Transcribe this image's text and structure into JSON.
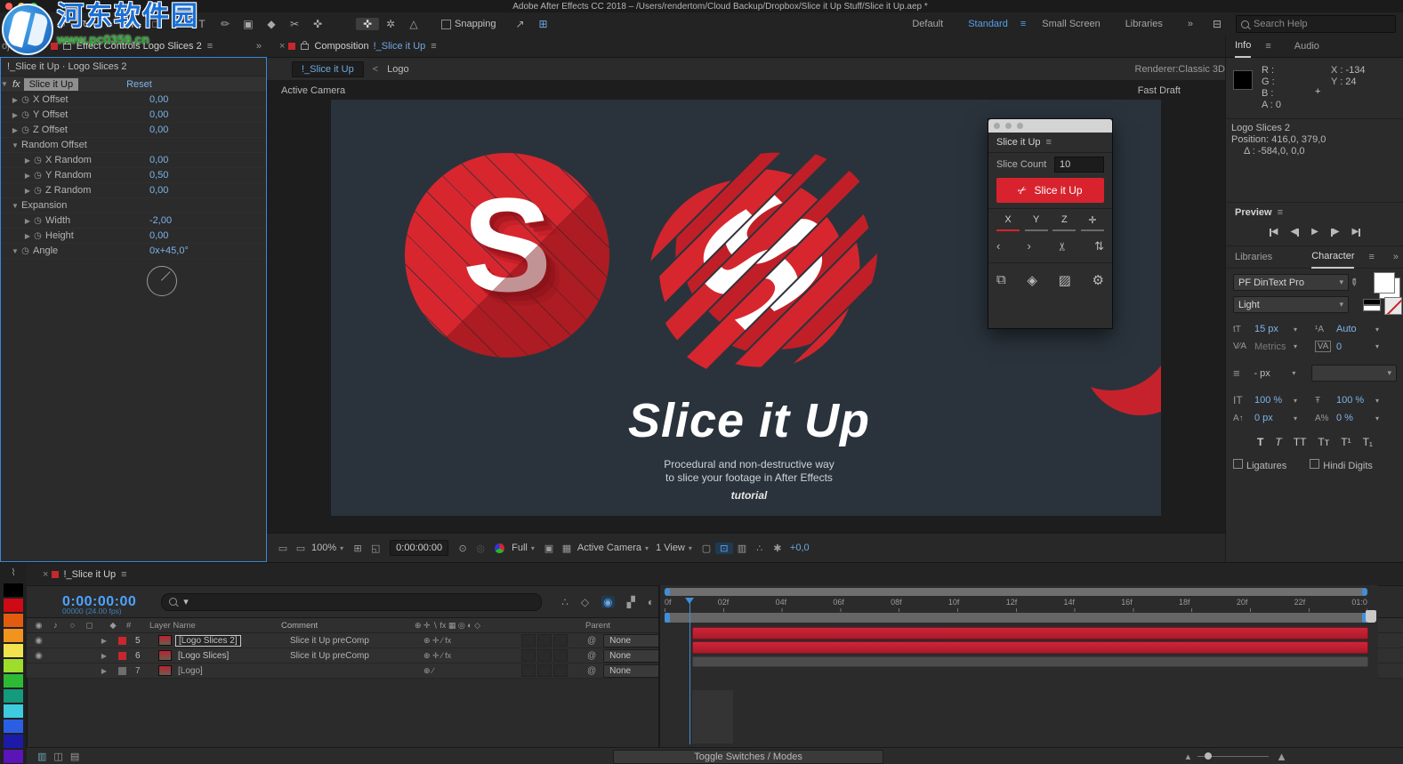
{
  "titlebar": {
    "title": "Adobe After Effects CC 2018 – /Users/rendertom/Cloud Backup/Dropbox/Slice it Up Stuff/Slice it Up.aep *"
  },
  "watermark": {
    "site_name": "河东软件园",
    "site_url": "www.pc0359.cn"
  },
  "toolbar": {
    "tools": [
      "↖",
      "✷",
      "⌕",
      "↻",
      "⌖",
      "✛",
      "□",
      "✒",
      "T",
      "✏",
      "▣",
      "◆",
      "✂",
      "✜"
    ],
    "tool_names": [
      "selection",
      "hand",
      "zoom",
      "rotate",
      "camera",
      "pan-behind",
      "shape",
      "pen",
      "type",
      "brush",
      "clone-stamp",
      "eraser",
      "roto-brush",
      "puppet-pin"
    ],
    "mid_tools": [
      "✜",
      "✲",
      "△"
    ],
    "snapping_label": "Snapping",
    "after_snap": [
      "↗",
      "⊞"
    ],
    "workspaces": [
      "Default",
      "Standard",
      "Small Screen",
      "Libraries"
    ],
    "active_workspace": "Standard",
    "workspace_menu_icon": "≡",
    "overflow": "»",
    "search_placeholder": "Search Help"
  },
  "effect_controls": {
    "project_tab_clip": "oject",
    "tab": "Effect Controls Logo Slices 2",
    "menu": "≡",
    "overflow": "»",
    "close": "×",
    "breadcrumb": "!_Slice it Up · Logo Slices 2",
    "fx_badge": "fx",
    "effect_name": "Slice it Up",
    "reset_label": "Reset",
    "rows": [
      {
        "label": "X Offset",
        "value": "0,00"
      },
      {
        "label": "Y Offset",
        "value": "0,00"
      },
      {
        "label": "Z Offset",
        "value": "0,00"
      },
      {
        "label": "Random Offset",
        "value": ""
      },
      {
        "label": "X Random",
        "value": "0,00"
      },
      {
        "label": "Y Random",
        "value": "0,50"
      },
      {
        "label": "Z Random",
        "value": "0,00"
      },
      {
        "label": "Expansion",
        "value": ""
      },
      {
        "label": "Width",
        "value": "-2,00"
      },
      {
        "label": "Height",
        "value": "0,00"
      },
      {
        "label": "Angle",
        "value": "0x+45,0°"
      }
    ]
  },
  "composition": {
    "close": "×",
    "tab_prefix": "Composition",
    "tab_comp": "!_Slice it Up",
    "menu": "≡",
    "crumb_active": "!_Slice it Up",
    "crumb_sep": "<",
    "crumb_other": "Logo",
    "renderer_label": "Renderer:",
    "renderer_value": "Classic 3D",
    "camera_label": "Active Camera",
    "fast_draft": "Fast Draft",
    "artwork": {
      "letter": "S",
      "title": "Slice it Up",
      "subtitle1": "Procedural and non-destructive way",
      "subtitle2": "to slice your footage in After Effects",
      "tagline": "tutorial",
      "bg_color": "#2a333c",
      "red": "#d8262e"
    },
    "toolbar": {
      "zoom": "100%",
      "timecode": "0:00:00:00",
      "resolution": "Full",
      "view": "Active Camera",
      "views": "1 View",
      "exposure": "+0,0"
    }
  },
  "script_panel": {
    "title": "Slice it Up",
    "menu": "≡",
    "slice_count_label": "Slice Count",
    "slice_count_value": "10",
    "button_label": "Slice it Up",
    "scissors": "✂",
    "axes": [
      "X",
      "Y",
      "Z",
      "✛"
    ],
    "row2": [
      "‹",
      "›",
      "✂",
      "⇅"
    ],
    "row3": [
      "⧉",
      "◈",
      "▨",
      "⚙"
    ],
    "accent": "#d8232e"
  },
  "info_panel": {
    "tab_info": "Info",
    "tab_audio": "Audio",
    "menu": "≡",
    "r": "R :",
    "g": "G :",
    "b": "B :",
    "a": "A :  0",
    "x": "X :  -134",
    "y": "Y :  24",
    "crosshair": "+",
    "layer": "Logo Slices 2",
    "position": "Position: 416,0, 379,0",
    "delta": "Δ : -584,0, 0,0"
  },
  "preview_panel": {
    "title": "Preview",
    "menu": "≡"
  },
  "character_panel": {
    "tab_libraries": "Libraries",
    "tab_character": "Character",
    "menu": "≡",
    "overflow": "»",
    "font": "PF DinText Pro",
    "style": "Light",
    "size_value": "15 px",
    "leading_value": "Auto",
    "kerning_value": "Metrics",
    "tracking_value": "0",
    "stroke_value": "- px",
    "vscale_value": "100 %",
    "hscale_value": "100 %",
    "baseline_value": "0 px",
    "tsume_value": "0 %",
    "icons": {
      "size": "tT",
      "leading": "¹A",
      "kerning": "V∕A",
      "tracking": "VA",
      "stroke": "≡",
      "vscale": "IT",
      "hscale": "Ŧ",
      "baseline": "A↑",
      "tsume": "A%"
    },
    "faux": [
      "T",
      "T",
      "TT",
      "Tᴛ",
      "T¹",
      "T₁"
    ],
    "ligatures_label": "Ligatures",
    "hindi_label": "Hindi Digits"
  },
  "timeline": {
    "close": "×",
    "tab": "!_Slice it Up",
    "menu": "≡",
    "timecode": "0:00:00:00",
    "frames": "00000 (24.00 fps)",
    "right_icons": [
      "∴",
      "◇",
      "◉",
      "▞",
      "◐",
      "∿"
    ],
    "right_icon_names": [
      "comp-mini-flowchart",
      "draft-3d",
      "hide-shy-layers",
      "frame-blending",
      "motion-blur",
      "graph-editor"
    ],
    "av_header_icons": [
      "◉",
      "♪",
      "○",
      "◻"
    ],
    "label_header_icon": "◆",
    "hash_header": "#",
    "headers": {
      "layer_name": "Layer Name",
      "comment": "Comment",
      "parent": "Parent"
    },
    "switch_header_icons": "⊕ ✛ ∖ fx ▦ ◎ ◐ ◇",
    "layers": [
      {
        "num": "5",
        "name": "[Logo Slices 2]",
        "comment": "Slice it Up preComp",
        "parent": "None",
        "label_color": "#c8272e",
        "switches": "⊕ ✛ ∕ fx",
        "bar": "red"
      },
      {
        "num": "6",
        "name": "[Logo Slices]",
        "comment": "Slice it Up preComp",
        "parent": "None",
        "label_color": "#c8272e",
        "switches": "⊕ ✛ ∕ fx",
        "bar": "red"
      },
      {
        "num": "7",
        "name": "[Logo]",
        "comment": "",
        "parent": "None",
        "label_color": "#6e6e6e",
        "switches": "⊕ ∕",
        "bar": "gray"
      }
    ],
    "eye_icon": "◉",
    "ruler_ticks": [
      "0f",
      "02f",
      "04f",
      "06f",
      "08f",
      "10f",
      "12f",
      "14f",
      "16f",
      "18f",
      "20f",
      "22f",
      "01:0"
    ],
    "bottom_icons": [
      "▥",
      "◫",
      "▤"
    ],
    "toggle_label": "Toggle Switches / Modes",
    "parent_pickwhip": "@"
  },
  "label_strip_colors": [
    "#000000",
    "#cf0a14",
    "#e35b0e",
    "#f0941e",
    "#f2e24e",
    "#9fdd2c",
    "#2dbb35",
    "#149a7d",
    "#3ecbdd",
    "#2b5fe3",
    "#1d1aa8",
    "#5a14b8"
  ]
}
